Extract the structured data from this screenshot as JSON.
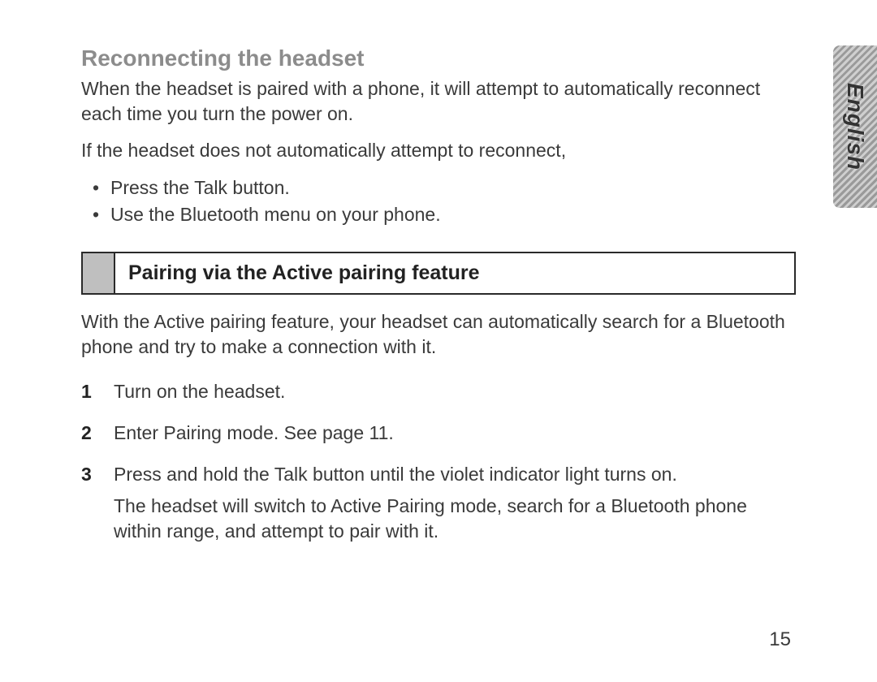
{
  "language_tab": "English",
  "page_number": "15",
  "section1": {
    "heading": "Reconnecting the headset",
    "para1": "When the headset is paired with a phone, it will attempt to automatically reconnect each time you turn the power on.",
    "para2": "If the headset does not automatically attempt to reconnect,",
    "bullets": [
      "Press the Talk button.",
      "Use the Bluetooth menu on your phone."
    ]
  },
  "section2": {
    "heading": "Pairing via the Active pairing feature",
    "para1": "With the Active pairing feature, your headset can automatically search for a Bluetooth phone and try to make a connection with it.",
    "steps": [
      {
        "text": "Turn on the headset."
      },
      {
        "text": "Enter Pairing mode. See page 11."
      },
      {
        "text": "Press and hold the Talk button until the violet indicator light turns on.",
        "note": "The headset will switch to Active Pairing mode, search for a Bluetooth phone within range, and attempt to pair with it."
      }
    ]
  }
}
